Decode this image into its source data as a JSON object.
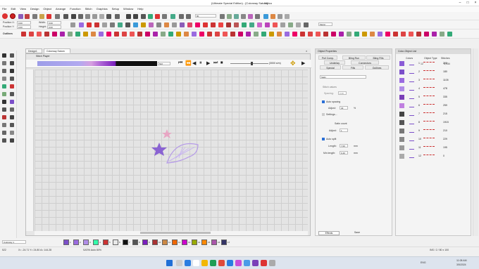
{
  "title": "(Ultimate Special Edition) - [Colorway Saturn]",
  "title_suffix": "Wolco",
  "menu": [
    "File",
    "Edit",
    "View",
    "Design",
    "Object",
    "Arrange",
    "Function",
    "Stitch",
    "Graphics",
    "Setup",
    "Window",
    "Help"
  ],
  "props": {
    "position_x": "Position X:",
    "position_y": "Position Y:",
    "width": "Width:",
    "height": "Height:",
    "x_val": "0.00",
    "y_val": "0.00",
    "w_val": "0.00",
    "h_val": "0.00"
  },
  "toolbar": {
    "zoom_value": "80",
    "units": "Metric",
    "outlines_label": "Outlines"
  },
  "doc_tabs": [
    "Design1",
    "Colorway Saturn"
  ],
  "stitch_player": {
    "label": "Stitch Player",
    "position": "522",
    "speed": "(3000 s/m)"
  },
  "object_properties": {
    "header": "Object Properties",
    "tabs_row1": [
      "Pull Comp.",
      "Bling Run",
      "Bling Fills"
    ],
    "tabs_row2": [
      "Underlay",
      "Connectors"
    ],
    "tabs_row3": [
      "Special",
      "Fills",
      "Outlines"
    ],
    "dropdown": "Satin",
    "stitch_values": "Stitch values",
    "spacing_label": "Spacing:",
    "spacing_val": "0.30",
    "auto_spacing": "Auto spacing",
    "adjust_label": "Adjust:",
    "adjust_val": "40",
    "adjust_unit": "%",
    "settings": "Settings...",
    "satin_count": "Satin count",
    "adjust2_label": "Adjust:",
    "adjust2_val": "1",
    "auto_split": "Auto split",
    "length_label": "Length:",
    "length_val": "7.00",
    "length_unit": "mm",
    "minlen_label": "Min length:",
    "minlen_val": "0.40",
    "minlen_unit": "mm",
    "effects_btn": "Effects",
    "save_btn": "Save"
  },
  "color_object_list": {
    "header": "Color-Object List",
    "columns": [
      "Colors",
      "Object Type",
      "Stitches"
    ],
    "top_row": {
      "index": "12",
      "total": "5,934"
    },
    "rows": [
      {
        "n": "1",
        "stitches": "200"
      },
      {
        "n": "2",
        "stitches": "180"
      },
      {
        "n": "3",
        "stitches": "1105"
      },
      {
        "n": "4",
        "stitches": "478"
      },
      {
        "n": "5",
        "stitches": "335"
      },
      {
        "n": "6",
        "stitches": "259"
      },
      {
        "n": "7",
        "stitches": "215"
      },
      {
        "n": "8",
        "stitches": "1915"
      },
      {
        "n": "9",
        "stitches": "210"
      },
      {
        "n": "10",
        "stitches": "229"
      },
      {
        "n": "11",
        "stitches": "195"
      },
      {
        "n": "12",
        "stitches": "0"
      }
    ]
  },
  "bottom": {
    "colorway": "Colorway 1",
    "mode": "SATIN Auto 80%",
    "coords": "X= -24.71 Y= 24.80 A= 144.28",
    "page_info": "INS / 2 / 80 x 100",
    "left_num": "522"
  },
  "palette_numbers": [
    "1",
    "2",
    "3",
    "4",
    "5",
    "6",
    "7",
    "8",
    "9",
    "10",
    "11",
    "12",
    "13",
    "14",
    "15",
    "16",
    "17"
  ],
  "taskbar": {
    "lang": "ENG",
    "time": "11:08 AM",
    "date": "3/5/2024"
  },
  "colors": {
    "accent": "#7b4fc9",
    "purple_light": "#b69be8",
    "pink": "#e8a0c0",
    "violet": "#8a63d2"
  }
}
